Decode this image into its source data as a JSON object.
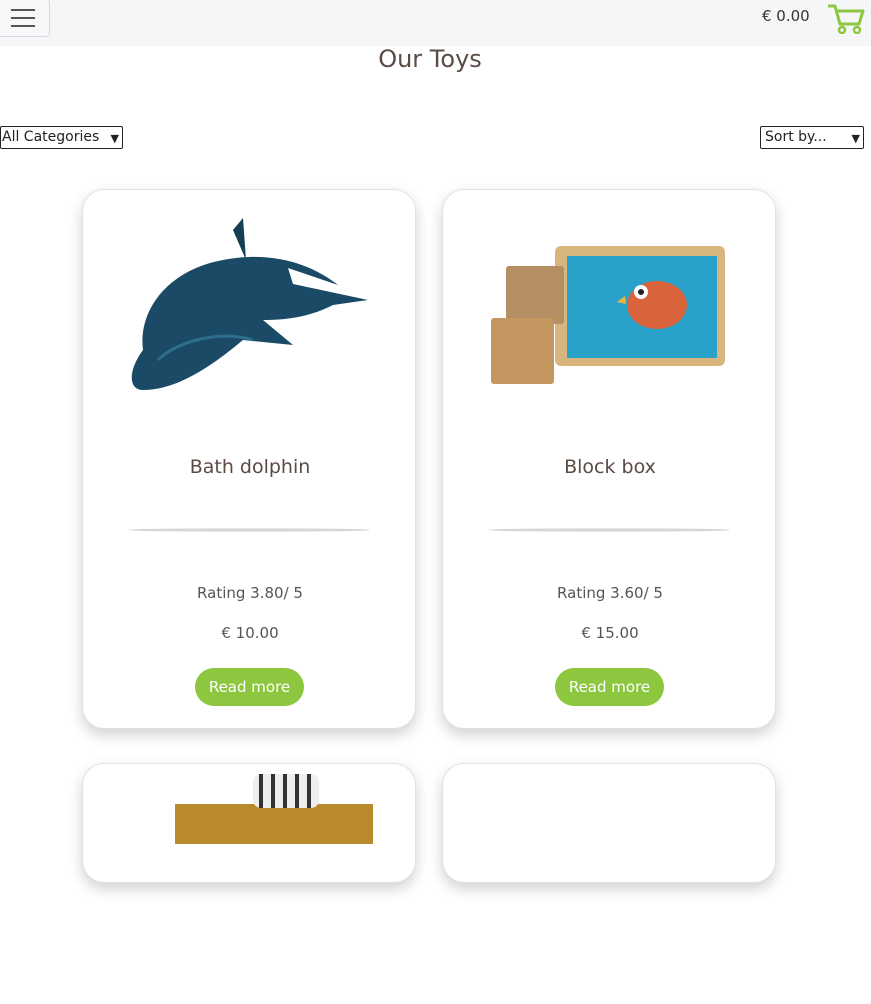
{
  "header": {
    "cart_total": "€ 0.00",
    "icons": {
      "menu": "hamburger-menu-icon",
      "cart": "shopping-cart-icon"
    },
    "accent_color": "#8dc63f"
  },
  "page": {
    "title": "Our Toys"
  },
  "filters": {
    "category_selected": "All Categories",
    "sort_selected": "Sort by..."
  },
  "products": [
    {
      "name": "Bath dolphin",
      "rating": "Rating 3.80/ 5",
      "price": "€ 10.00",
      "button": "Read more"
    },
    {
      "name": "Block box",
      "rating": "Rating 3.60/ 5",
      "price": "€ 15.00",
      "button": "Read more"
    }
  ]
}
